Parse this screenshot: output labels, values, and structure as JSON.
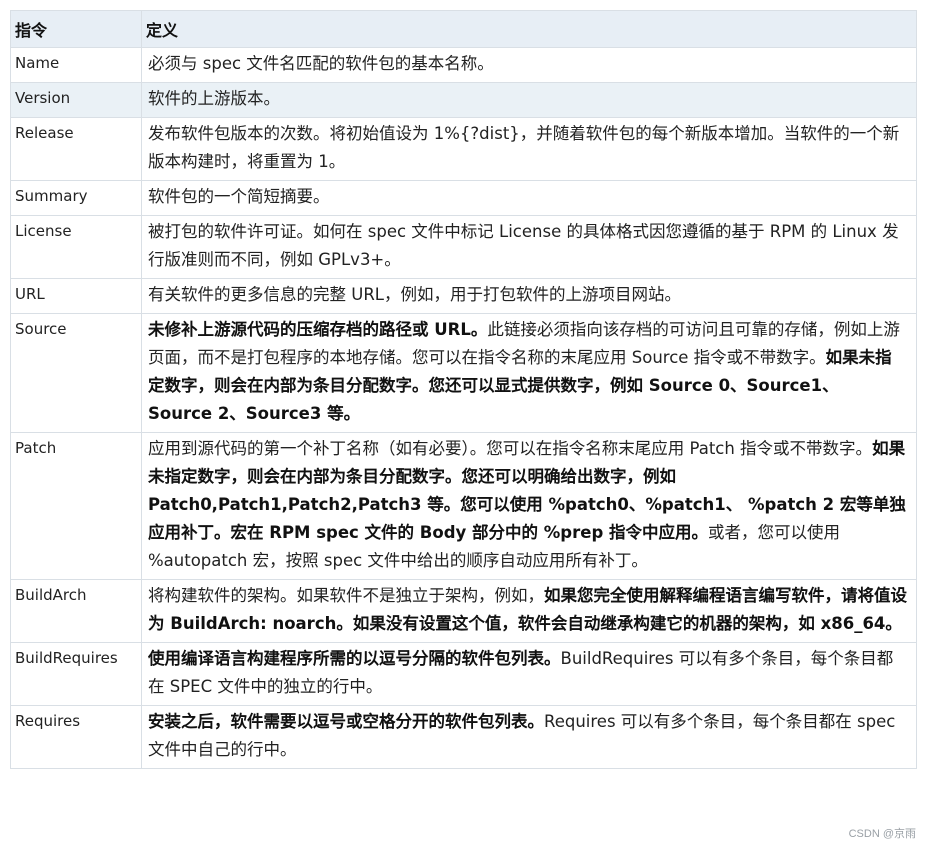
{
  "table": {
    "header": {
      "term": "指令",
      "definition": "定义"
    },
    "rows": [
      {
        "term": "Name",
        "parts": [
          {
            "t": "必须与 spec 文件名匹配的软件包的基本名称。",
            "b": false
          }
        ]
      },
      {
        "term": "Version",
        "parts": [
          {
            "t": "软件的上游版本。",
            "b": false
          }
        ]
      },
      {
        "term": "Release",
        "parts": [
          {
            "t": "发布软件包版本的次数。将初始值设为 1%{?dist}，并随着软件包的每个新版本增加。当软件的一个新版本构建时，将重置为 1。",
            "b": false
          }
        ]
      },
      {
        "term": "Summary",
        "parts": [
          {
            "t": "软件包的一个简短摘要。",
            "b": false
          }
        ]
      },
      {
        "term": "License",
        "parts": [
          {
            "t": "被打包的软件许可证。如何在 spec 文件中标记 License 的具体格式因您遵循的基于 RPM 的 Linux 发行版准则而不同，例如 GPLv3+。",
            "b": false
          }
        ]
      },
      {
        "term": "URL",
        "parts": [
          {
            "t": "有关软件的更多信息的完整 URL，例如，用于打包软件的上游项目网站。",
            "b": false
          }
        ]
      },
      {
        "term": "Source",
        "parts": [
          {
            "t": "未修补上游源代码的压缩存档的路径或 URL。",
            "b": true
          },
          {
            "t": "此链接必须指向该存档的可访问且可靠的存储，例如上游页面，而不是打包程序的本地存储。您可以在指令名称的末尾应用 Source 指令或不带数字。",
            "b": false
          },
          {
            "t": "如果未指定数字，则会在内部为条目分配数字。您还可以显式提供数字，例如 Source 0、Source1、 Source 2、Source3 等。",
            "b": true
          }
        ]
      },
      {
        "term": "Patch",
        "parts": [
          {
            "t": "应用到源代码的第一个补丁名称（如有必要）。您可以在指令名称末尾应用 Patch 指令或不带数字。",
            "b": false
          },
          {
            "t": "如果未指定数字，则会在内部为条目分配数字。您还可以明确给出数字，例如 Patch0,Patch1,Patch2,Patch3 等。您可以使用 %patch0、%patch1、 %patch 2 宏等单独应用补丁。宏在 RPM spec 文件的 Body 部分中的 %prep 指令中应用。",
            "b": true
          },
          {
            "t": "或者，您可以使用 %autopatch 宏，按照 spec 文件中给出的顺序自动应用所有补丁。",
            "b": false
          }
        ]
      },
      {
        "term": "BuildArch",
        "parts": [
          {
            "t": "将构建软件的架构。如果软件不是独立于架构，例如，",
            "b": false
          },
          {
            "t": "如果您完全使用解释编程语言编写软件，请将值设为 BuildArch: noarch。如果没有设置这个值，软件会自动继承构建它的机器的架构，如 x86_64。",
            "b": true
          }
        ]
      },
      {
        "term": "BuildRequires",
        "parts": [
          {
            "t": "使用编译语言构建程序所需的以逗号分隔的软件包列表。",
            "b": true
          },
          {
            "t": "BuildRequires 可以有多个条目，每个条目都在 SPEC 文件中的独立的行中。",
            "b": false
          }
        ]
      },
      {
        "term": "Requires",
        "parts": [
          {
            "t": "安装之后，软件需要以逗号或空格分开的软件包列表。",
            "b": true
          },
          {
            "t": "Requires 可以有多个条目，每个条目都在 spec 文件中自己的行中。",
            "b": false
          }
        ]
      }
    ]
  },
  "watermark": "CSDN @京雨",
  "colors": {
    "header_bg": "#e7eef5",
    "alt_row_bg": "#eaf1f6",
    "border": "#d9dfe5"
  }
}
